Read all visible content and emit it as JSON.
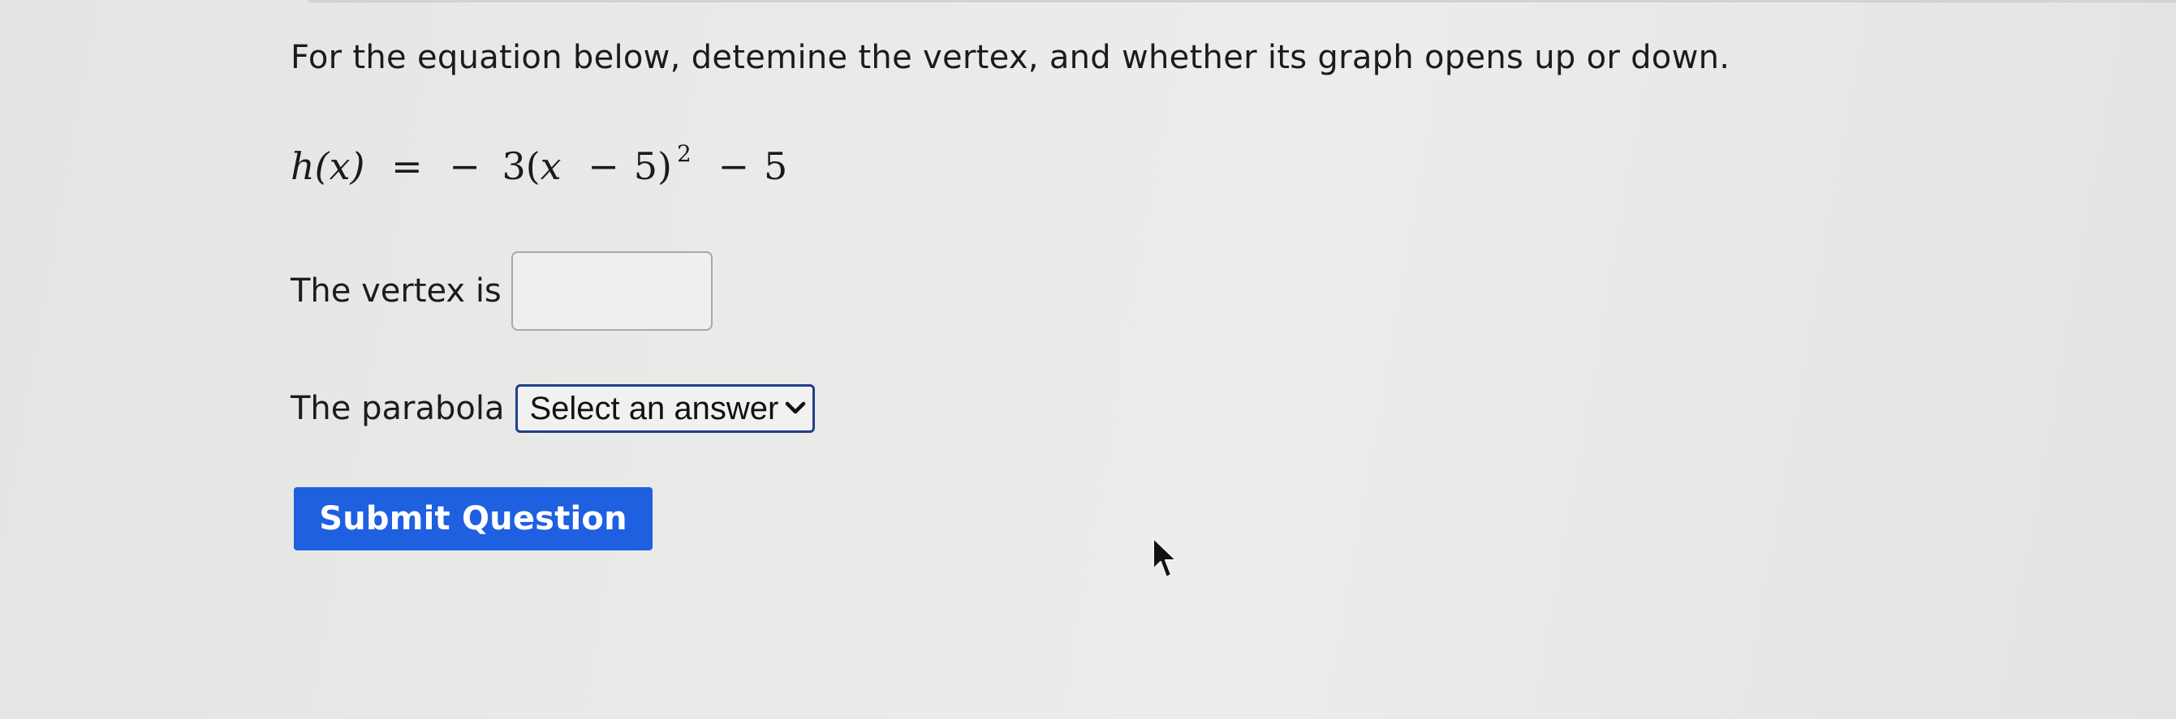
{
  "question": {
    "prompt": "For the equation below, detemine the vertex, and whether its graph opens up or down.",
    "equation": {
      "lhs": "h(x)",
      "equals": "=",
      "neg": "−",
      "coef": "3(",
      "var": "x",
      "minus1": "−",
      "const1": "5)",
      "exponent": "2",
      "minus2": "−",
      "const2": "5"
    }
  },
  "vertex": {
    "label": "The vertex is",
    "value": ""
  },
  "parabola": {
    "label": "The parabola",
    "selected": "Select an answer"
  },
  "actions": {
    "submit_label": "Submit Question"
  },
  "icons": {
    "dropdown": "chevron-down-icon",
    "pointer": "mouse-cursor-icon"
  },
  "colors": {
    "button": "#1f60e0",
    "select_border": "#1f3f8a"
  }
}
